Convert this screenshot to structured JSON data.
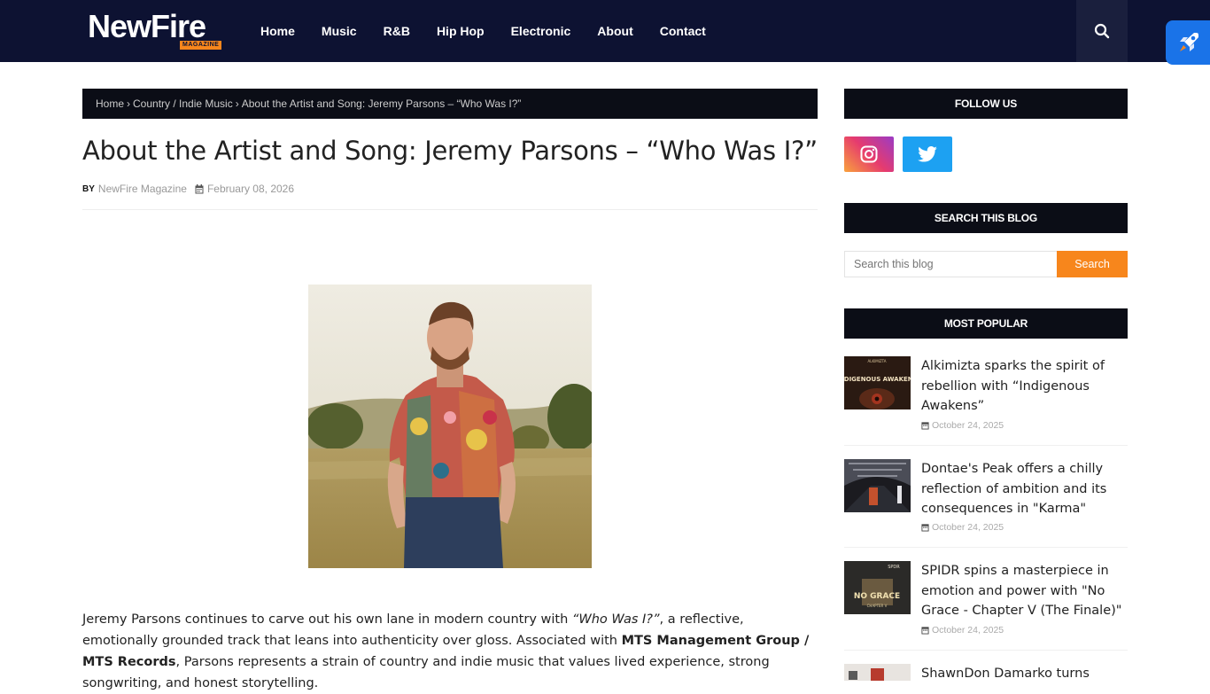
{
  "header": {
    "logo_text": "NewFire",
    "logo_tag": "MAGAZINE",
    "nav": [
      "Home",
      "Music",
      "R&B",
      "Hip Hop",
      "Electronic",
      "About",
      "Contact"
    ]
  },
  "breadcrumb": {
    "home": "Home",
    "sep": "›",
    "category": "Country / Indie Music",
    "current": "About the Artist and Song: Jeremy Parsons – “Who Was I?”"
  },
  "post": {
    "title": "About the Artist and Song: Jeremy Parsons – “Who Was I?”",
    "by_label": "BY",
    "author": "NewFire Magazine",
    "date": "February 08, 2026",
    "body_1": "Jeremy Parsons continues to carve out his own lane in modern country with ",
    "body_song": "“Who Was I?”",
    "body_2": ", a reflective, emotionally grounded track that leans into authenticity over gloss. Associated with ",
    "body_label": "MTS Management Group / MTS Records",
    "body_3": ", Parsons represents a strain of country and indie music that values lived experience, strong songwriting, and honest storytelling."
  },
  "sidebar": {
    "follow_title": "FOLLOW US",
    "search_title": "SEARCH THIS BLOG",
    "search_placeholder": "Search this blog",
    "search_button": "Search",
    "popular_title": "MOST POPULAR",
    "popular": [
      {
        "title": "Alkimizta sparks the spirit of rebellion with “Indigenous Awakens”",
        "date": "October 24, 2025",
        "thumb_text": "INDIGENOUS AWAKENS",
        "thumb_sup": "ALKIMIZTA"
      },
      {
        "title": "Dontae's Peak offers a chilly reflection of ambition and its consequences in \"Karma\"",
        "date": "October 24, 2025"
      },
      {
        "title": "SPIDR spins a masterpiece in emotion and power with \"No Grace - Chapter V (The Finale)\"",
        "date": "October 24, 2025",
        "thumb_text": "NO GRACE",
        "thumb_sup": "SPDR",
        "thumb_sub": "CHAPTER V"
      },
      {
        "title": "ShawnDon Damarko turns survival",
        "date": ""
      }
    ]
  },
  "colors": {
    "header_bg": "#0d1232",
    "accent_orange": "#f7861c",
    "widget_bg": "#0b0d16",
    "twitter": "#1da1f2",
    "rocket_blue": "#1a73e8"
  },
  "icons": [
    "search-icon",
    "rocket-icon",
    "instagram-icon",
    "twitter-icon",
    "calendar-icon"
  ]
}
